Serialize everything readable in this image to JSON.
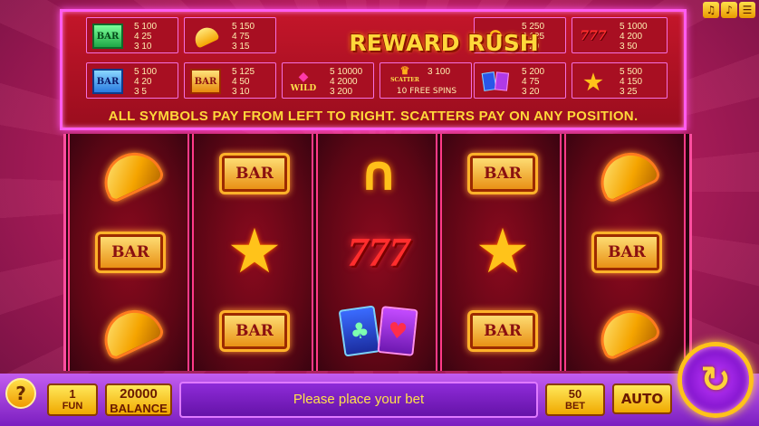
{
  "game": {
    "title": "REWARD RUSH",
    "rule": "ALL SYMBOLS PAY FROM LEFT TO RIGHT. SCATTERS PAY ON ANY POSITION."
  },
  "utility_icons": [
    "speaker-icon",
    "music-note-icon",
    "hamburger-menu-icon"
  ],
  "paytable": {
    "left": [
      {
        "name": "triple-bar-green",
        "label": "BAR",
        "pays": [
          "5 100",
          "4 25",
          "3 10"
        ]
      },
      {
        "name": "bell",
        "label": "",
        "pays": [
          "5 150",
          "4 75",
          "3 15"
        ]
      },
      {
        "name": "single-bar-blue",
        "label": "BAR",
        "pays": [
          "5 100",
          "4 20",
          "3 5"
        ]
      },
      {
        "name": "double-bar-orange",
        "label": "BAR",
        "pays": [
          "5 125",
          "4 50",
          "3 10"
        ]
      },
      {
        "name": "wild-gem",
        "label": "WILD",
        "pays": [
          "5 10000",
          "4 2000",
          "3 200"
        ]
      },
      {
        "name": "scatter-crown",
        "label": "SCATTER",
        "pays": [
          "3 100",
          "10 FREE SPINS"
        ]
      }
    ],
    "right": [
      {
        "name": "horseshoe",
        "label": "",
        "pays": [
          "5 250",
          "4 125",
          "3 20"
        ]
      },
      {
        "name": "sevens",
        "label": "777",
        "pays": [
          "5 1000",
          "4 200",
          "3 50"
        ]
      },
      {
        "name": "cards",
        "label": "",
        "pays": [
          "5 200",
          "4 75",
          "3 20"
        ]
      },
      {
        "name": "star",
        "label": "",
        "pays": [
          "5 500",
          "4 150",
          "3 25"
        ]
      }
    ]
  },
  "reels": [
    [
      "bell",
      "bar",
      "bell"
    ],
    [
      "bar",
      "star",
      "bar"
    ],
    [
      "horseshoe",
      "sevens",
      "cards"
    ],
    [
      "bar",
      "star",
      "bar"
    ],
    [
      "bell",
      "bar",
      "bell"
    ]
  ],
  "symbol_text": {
    "bar": "BAR",
    "sevens": "777"
  },
  "bottom": {
    "help_label": "?",
    "fun_value": "1",
    "fun_label": "FUN",
    "balance_value": "20000",
    "balance_label": "BALANCE",
    "message": "Please place your bet",
    "bet_value": "50",
    "bet_label": "BET",
    "auto_label": "AUTO",
    "spin_icon": "spin-refresh-icon"
  }
}
